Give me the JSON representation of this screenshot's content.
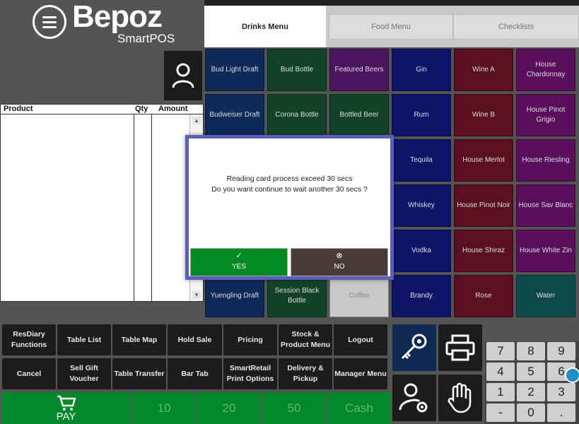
{
  "brand": {
    "name": "Bepoz",
    "product": "SmartPOS"
  },
  "tabs": [
    {
      "label": "Drinks Menu"
    },
    {
      "label": "Food Menu"
    },
    {
      "label": "Checklists"
    }
  ],
  "order_table": {
    "col_product": "Product",
    "col_qty": "Qty",
    "col_amount": "Amount"
  },
  "products": [
    {
      "label": "Bud Light Draft",
      "color": "#0c2b58"
    },
    {
      "label": "Bud Bottle",
      "color": "#12432a"
    },
    {
      "label": "Featured Beers",
      "color": "#4c1560"
    },
    {
      "label": "Gin",
      "color": "#0e1468"
    },
    {
      "label": "Wine A",
      "color": "#5a1020"
    },
    {
      "label": "House Chardonnay",
      "color": "#5a0f5c"
    },
    {
      "label": "Budweiser Draft",
      "color": "#0c2b58"
    },
    {
      "label": "Corona Bottle",
      "color": "#12432a"
    },
    {
      "label": "Bottled Beer",
      "color": "#12432a"
    },
    {
      "label": "Rum",
      "color": "#0e1468"
    },
    {
      "label": "Wine B",
      "color": "#5a1020"
    },
    {
      "label": "House Pinot Grigio",
      "color": "#5a0f5c"
    },
    {
      "label": "Tequila",
      "color": "#0e1468"
    },
    {
      "label": "House Merlot",
      "color": "#5a1020"
    },
    {
      "label": "House Riesling",
      "color": "#5a0f5c"
    },
    {
      "label": "Whiskey",
      "color": "#0e1468"
    },
    {
      "label": "House Pinot Noir",
      "color": "#5a1020"
    },
    {
      "label": "House Sav Blanc",
      "color": "#5a0f5c"
    },
    {
      "label": "Vodka",
      "color": "#0e1468"
    },
    {
      "label": "House Shiraz",
      "color": "#5a1020"
    },
    {
      "label": "House White Zin",
      "color": "#5a0f5c"
    },
    {
      "label": "Yuengling Draft",
      "color": "#0c2b58"
    },
    {
      "label": "Session Black Bottle",
      "color": "#12432a"
    },
    {
      "label": "Coffee",
      "color": "#c8c8c8"
    },
    {
      "label": "Brandy",
      "color": "#0e1468"
    },
    {
      "label": "Rose",
      "color": "#5a1020"
    },
    {
      "label": "Water",
      "color": "#0c4a4a"
    }
  ],
  "functions": [
    {
      "label": "ResDiary Functions"
    },
    {
      "label": "Table List"
    },
    {
      "label": "Table Map"
    },
    {
      "label": "Hold Sale"
    },
    {
      "label": "Pricing"
    },
    {
      "label": "Stock & Product Menu"
    },
    {
      "label": "Logout"
    },
    {
      "label": "Cancel"
    },
    {
      "label": "Sell Gift Voucher"
    },
    {
      "label": "Table Transfer"
    },
    {
      "label": "Bar Tab"
    },
    {
      "label": "SmartRetail Print Options"
    },
    {
      "label": "Delivery & Pickup"
    },
    {
      "label": "Manager Menu"
    }
  ],
  "payment": {
    "pay": "PAY",
    "b10": "10",
    "b20": "20",
    "b50": "50",
    "cash": "Cash"
  },
  "keypad": [
    "7",
    "8",
    "9",
    "4",
    "5",
    "6",
    "1",
    "2",
    "3",
    "-",
    "0",
    "."
  ],
  "dialog": {
    "line1": "Reading card process exceed 30 secs",
    "line2": "Do you want continue to wait another 30 secs ?",
    "yes": "YES",
    "no": "NO",
    "yes_color": "#008a22",
    "no_color": "#4a3b38"
  }
}
